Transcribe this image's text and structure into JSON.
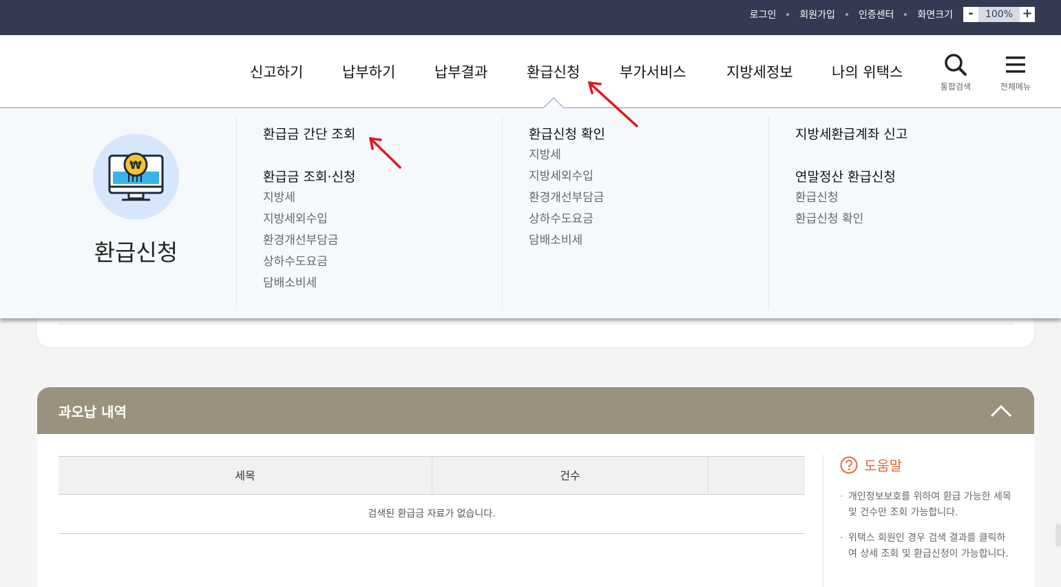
{
  "utility": {
    "login": "로그인",
    "signup": "회원가입",
    "cert_center": "인증센터",
    "screen_size": "화면크기",
    "zoom_minus": "-",
    "zoom_value": "100%",
    "zoom_plus": "+"
  },
  "gnb": {
    "menus": [
      "신고하기",
      "납부하기",
      "납부결과",
      "환급신청",
      "부가서비스",
      "지방세정보",
      "나의 위택스"
    ],
    "search_label": "통합검색",
    "allmenu_label": "전체메뉴"
  },
  "mega": {
    "title": "환급신청",
    "col1": {
      "h1": "환급금 간단 조회",
      "h2": "환급금 조회·신청",
      "items": [
        "지방세",
        "지방세외수입",
        "환경개선부담금",
        "상하수도요금",
        "담배소비세"
      ]
    },
    "col2": {
      "h1": "환급신청 확인",
      "items": [
        "지방세",
        "지방세외수입",
        "환경개선부담금",
        "상하수도요금",
        "담배소비세"
      ]
    },
    "col3": {
      "h1": "지방세환급계좌 신고",
      "h2": "연말정산 환급신청",
      "items": [
        "환급신청",
        "환급신청 확인"
      ]
    }
  },
  "panel": {
    "title": "과오납 내역",
    "table": {
      "headers": [
        "세목",
        "건수",
        ""
      ],
      "empty_message": "검색된 환급금 자료가 없습니다."
    }
  },
  "help": {
    "title": "도움말",
    "items": [
      "개인정보보호를 위하여 환급 가능한 세목 및 건수만 조회 가능합니다.",
      "위택스 회원인 경우 검색 결과를 클릭하여 상세 조회 및 환급신청이 가능합니다."
    ]
  },
  "colors": {
    "topbar": "#333a52",
    "panel_header": "#9a917f",
    "help_accent": "#e8683a",
    "annotation_arrow": "#e0161e"
  }
}
